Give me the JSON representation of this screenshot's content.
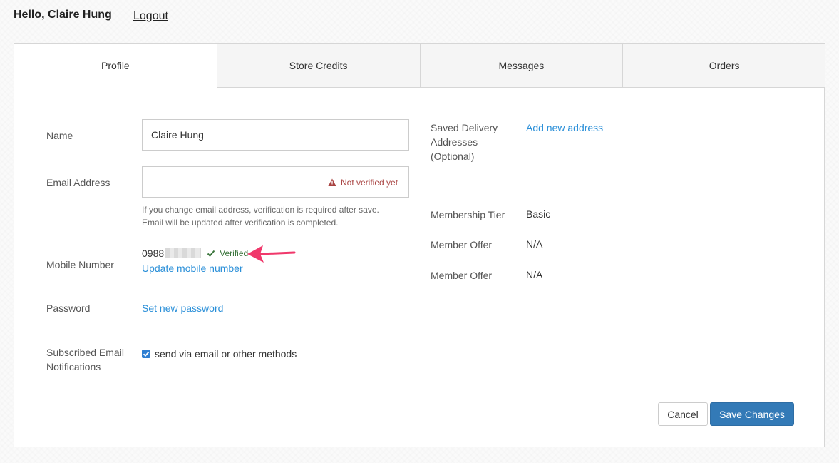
{
  "header": {
    "greeting": "Hello, Claire Hung",
    "logout_label": "Logout"
  },
  "tabs": [
    {
      "label": "Profile",
      "active": true
    },
    {
      "label": "Store Credits",
      "active": false
    },
    {
      "label": "Messages",
      "active": false
    },
    {
      "label": "Orders",
      "active": false
    }
  ],
  "profile": {
    "name_label": "Name",
    "name_value": "Claire Hung",
    "email_label": "Email Address",
    "email_value": "",
    "email_status": "Not verified yet",
    "email_help_line1": "If you change email address, verification is required after save.",
    "email_help_line2": "Email will be updated after verification is completed.",
    "mobile_label": "Mobile Number",
    "mobile_value": "0988",
    "mobile_status": "Verified",
    "mobile_update_link": "Update mobile number",
    "password_label": "Password",
    "password_link": "Set new password",
    "subscribed_label_line1": "Subscribed Email",
    "subscribed_label_line2": "Notifications",
    "subscribed_checked": true,
    "subscribed_option": "send via email or other methods"
  },
  "right": {
    "saved_addresses_line1": "Saved Delivery",
    "saved_addresses_line2": "Addresses",
    "saved_addresses_line3": "(Optional)",
    "add_address_link": "Add new address",
    "membership_label": "Membership Tier",
    "membership_value": "Basic",
    "offer1_label": "Member Offer",
    "offer1_value": "N/A",
    "offer2_label": "Member Offer",
    "offer2_value": "N/A"
  },
  "actions": {
    "cancel_label": "Cancel",
    "save_label": "Save Changes"
  },
  "colors": {
    "link": "#2a8fd8",
    "primary_button": "#337ab7",
    "warning": "#a94442",
    "success": "#3c763d",
    "annotation_arrow": "#f0386b"
  }
}
